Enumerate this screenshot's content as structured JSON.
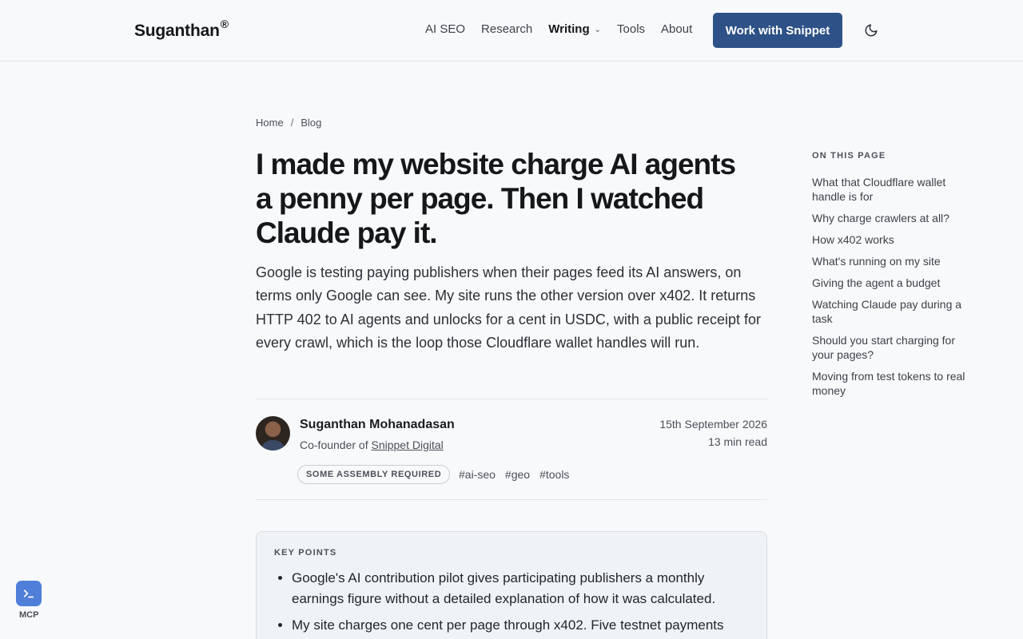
{
  "header": {
    "logo": "Suganthan",
    "logo_mark": "®",
    "nav": [
      {
        "label": "AI SEO"
      },
      {
        "label": "Research"
      },
      {
        "label": "Writing"
      },
      {
        "label": "Tools"
      },
      {
        "label": "About"
      }
    ],
    "cta_label": "Work with Snippet",
    "theme_icon": "moon-icon"
  },
  "breadcrumb": {
    "home": "Home",
    "sep": "/",
    "current": "Blog"
  },
  "article": {
    "title": "I made my website charge AI agents a penny per page. Then I watched Claude pay it.",
    "lede": "Google is testing paying publishers when their pages feed its AI answers, on terms only Google can see. My site runs the other version over x402. It returns HTTP 402 to AI agents and unlocks for a cent in USDC, with a public receipt for every crawl, which is the loop those Cloudflare wallet handles will run.",
    "author": {
      "name": "Suganthan Mohanadasan",
      "role_prefix": "Co-founder of ",
      "company": "Snippet Digital"
    },
    "date": "15th September 2026",
    "read_time": "13 min read",
    "badge": "SOME ASSEMBLY REQUIRED",
    "tags": [
      "#ai-seo",
      "#geo",
      "#tools"
    ]
  },
  "key_points": {
    "label": "KEY POINTS",
    "items": [
      "Google's AI contribution pilot gives participating publishers a monthly earnings figure without a detailed explanation of how it was calculated.",
      "My site charges one cent per page through x402. Five testnet payments"
    ]
  },
  "toc": {
    "label": "ON THIS PAGE",
    "items": [
      "What that Cloudflare wallet handle is for",
      "Why charge crawlers at all?",
      "How x402 works",
      "What's running on my site",
      "Giving the agent a budget",
      "Watching Claude pay during a task",
      "Should you start charging for your pages?",
      "Moving from test tokens to real money"
    ]
  },
  "mcp": {
    "label": "MCP",
    "icon": "terminal-icon"
  },
  "colors": {
    "accent": "#2e5287",
    "mcp": "#4f7fd9",
    "background": "#f8f9fb"
  }
}
